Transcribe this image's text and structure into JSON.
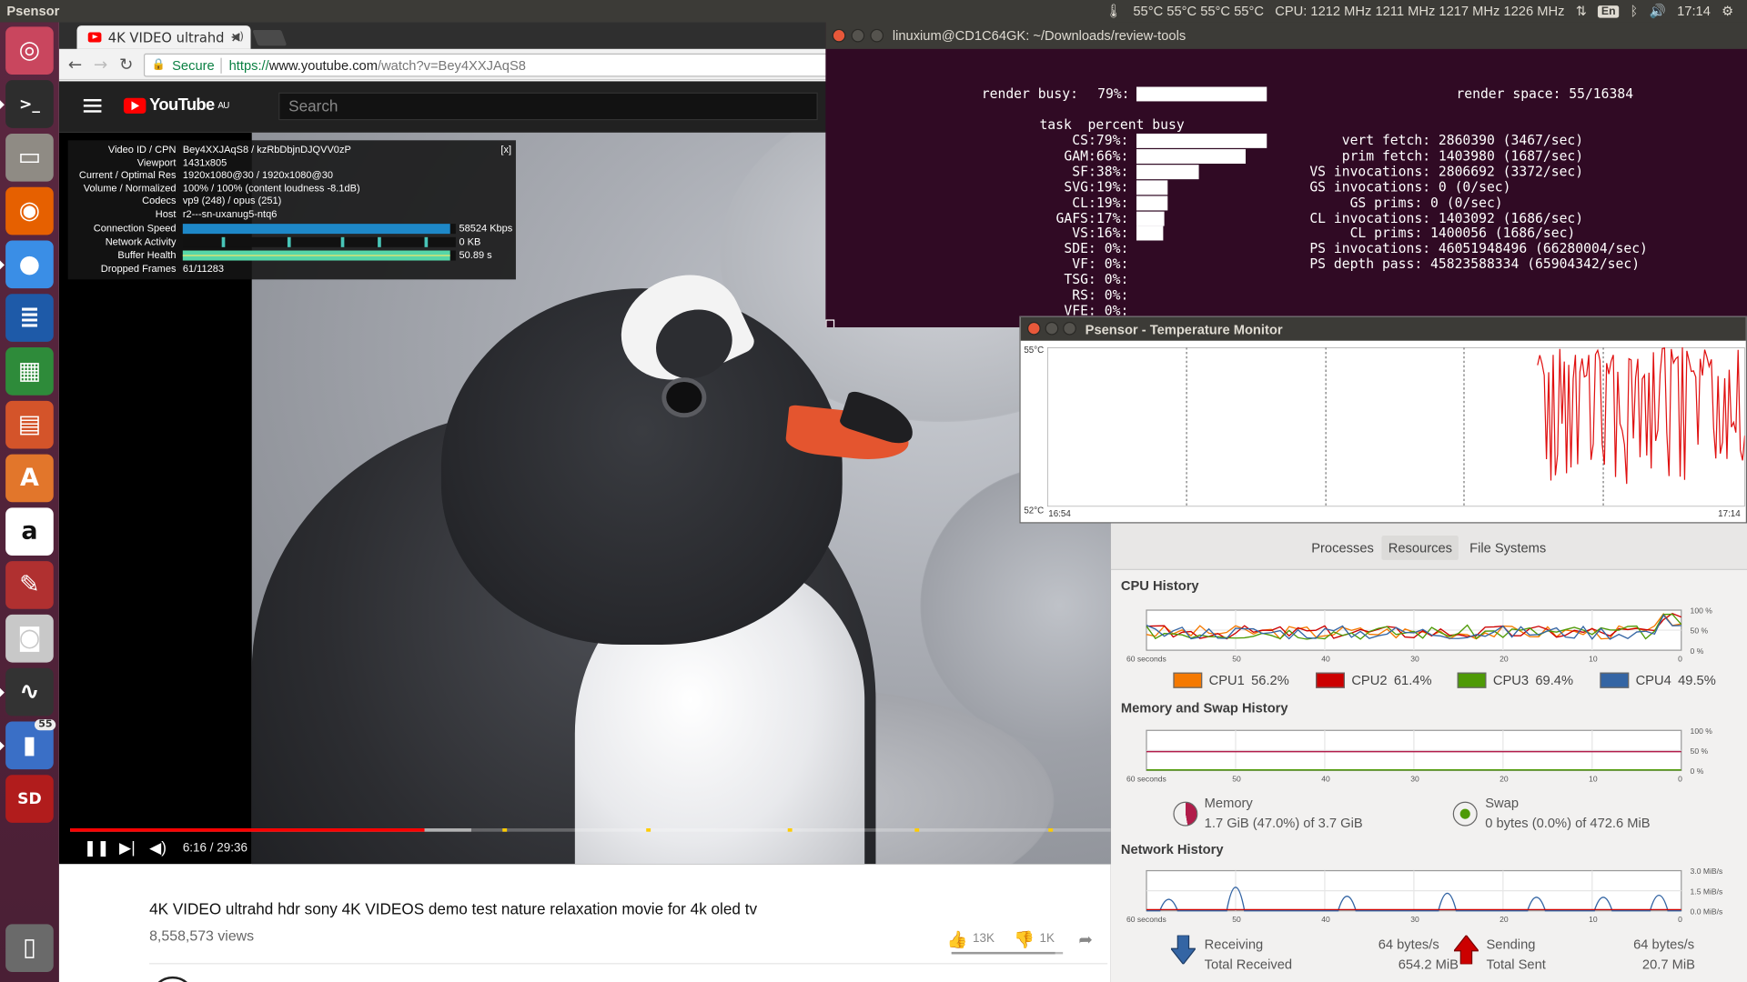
{
  "top_panel": {
    "app_title": "Psensor",
    "temps": "55°C 55°C 55°C 55°C",
    "cpu_freqs": "CPU: 1212 MHz 1211 MHz 1217 MHz 1226 MHz",
    "keyboard_layout": "En",
    "clock": "17:14"
  },
  "launcher": {
    "items": [
      {
        "name": "ubuntu-dash",
        "glyph": "◎",
        "color": "#c9465e"
      },
      {
        "name": "terminal",
        "glyph": ">_",
        "color": "#2d2d2d"
      },
      {
        "name": "files",
        "glyph": "▭",
        "color": "#8f8b84"
      },
      {
        "name": "firefox",
        "glyph": "◉",
        "color": "#e66000"
      },
      {
        "name": "chrome",
        "glyph": "●",
        "color": "#3a8ee6"
      },
      {
        "name": "writer",
        "glyph": "≣",
        "color": "#1e5aa8"
      },
      {
        "name": "calc",
        "glyph": "▦",
        "color": "#2e8b3a"
      },
      {
        "name": "impress",
        "glyph": "▤",
        "color": "#d4542a"
      },
      {
        "name": "software-center",
        "glyph": "A",
        "color": "#e2762b"
      },
      {
        "name": "amazon",
        "glyph": "a",
        "color": "#ffffff"
      },
      {
        "name": "system-settings",
        "glyph": "✎",
        "color": "#b03030"
      },
      {
        "name": "camera",
        "glyph": "◙",
        "color": "#c8c8c8"
      },
      {
        "name": "system-monitor",
        "glyph": "∿",
        "color": "#333333"
      },
      {
        "name": "psensor",
        "glyph": "▮",
        "color": "#3a6fc6",
        "badge": "55"
      },
      {
        "name": "sd-card",
        "glyph": "SD",
        "color": "#b11c1c"
      },
      {
        "name": "trash",
        "glyph": "▯",
        "color": "#6a6a6a"
      }
    ]
  },
  "browser": {
    "tab_title": "4K VIDEO ultrahd",
    "secure_label": "Secure",
    "url_scheme": "https://",
    "url_host": "www.youtube.com",
    "url_path": "/watch?v=Bey4XXJAqS8",
    "yt_region": "AU",
    "yt_logo": "YouTube",
    "search_placeholder": "Search"
  },
  "stats": {
    "close": "[x]",
    "rows": [
      {
        "key": "Video ID / CPN",
        "val": "Bey4XXJAqS8 / kzRbDbjnDJQVV0zP"
      },
      {
        "key": "Viewport",
        "val": "1431x805"
      },
      {
        "key": "Current / Optimal Res",
        "val": "1920x1080@30 / 1920x1080@30"
      },
      {
        "key": "Volume / Normalized",
        "val": "100% / 100% (content loudness -8.1dB)"
      },
      {
        "key": "Codecs",
        "val": "vp9 (248) / opus (251)"
      },
      {
        "key": "Host",
        "val": "r2---sn-uxanug5-ntq6"
      }
    ],
    "bars": [
      {
        "key": "Connection Speed",
        "val": "58524 Kbps",
        "color": "#1e88c8",
        "fill": 0.98
      },
      {
        "key": "Network Activity",
        "val": "0 KB",
        "color": "#48c5b8",
        "fill": 0.0
      },
      {
        "key": "Buffer Health",
        "val": "50.89 s",
        "color": "#56d6a8",
        "fill": 0.98
      }
    ],
    "dropped_key": "Dropped Frames",
    "dropped_val": "61/11283"
  },
  "player": {
    "played_fraction": 0.34,
    "buffered_fraction": 0.385,
    "markers": [
      0.415,
      0.553,
      0.69,
      0.812,
      0.94
    ],
    "time": "6:16 / 29:36"
  },
  "video": {
    "title": "4K VIDEO ultrahd hdr sony 4K VIDEOS demo test nature relaxation movie for 4k oled tv",
    "views": "8,558,573 views",
    "likes": "13K",
    "dislikes": "1K"
  },
  "terminal": {
    "title": "linuxium@CD1C64GK: ~/Downloads/review-tools",
    "render_busy_label": "render busy:",
    "render_busy_pct": "79%:",
    "render_busy_value": 79,
    "render_space": "render space: 55/16384",
    "header": "task  percent busy",
    "tasks": [
      {
        "name": "CS:",
        "pct": "79%:",
        "value": 79
      },
      {
        "name": "GAM:",
        "pct": "66%:",
        "value": 66
      },
      {
        "name": "SF:",
        "pct": "38%:",
        "value": 38
      },
      {
        "name": "SVG:",
        "pct": "19%:",
        "value": 19
      },
      {
        "name": "CL:",
        "pct": "19%:",
        "value": 19
      },
      {
        "name": "GAFS:",
        "pct": "17%:",
        "value": 17
      },
      {
        "name": "VS:",
        "pct": "16%:",
        "value": 16
      },
      {
        "name": "SDE:",
        "pct": "0%:",
        "value": 0
      },
      {
        "name": "VF:",
        "pct": "0%:",
        "value": 0
      },
      {
        "name": "TSG:",
        "pct": "0%:",
        "value": 0
      },
      {
        "name": "RS:",
        "pct": "0%:",
        "value": 0
      },
      {
        "name": "VFE:",
        "pct": "0%:",
        "value": 0
      }
    ],
    "stats": [
      "      vert fetch: 2860390 (3467/sec)",
      "      prim fetch: 1403980 (1687/sec)",
      "  VS invocations: 2806692 (3372/sec)",
      "  GS invocations: 0 (0/sec)",
      "       GS prims: 0 (0/sec)",
      "  CL invocations: 1403092 (1686/sec)",
      "       CL prims: 1400056 (1686/sec)",
      "  PS invocations: 46051948496 (66280004/sec)",
      "  PS depth pass: 45823588334 (65904342/sec)"
    ]
  },
  "psensor": {
    "title": "Psensor - Temperature Monitor",
    "y_max": "55°C",
    "y_min": "52°C",
    "x_start": "16:54",
    "x_end": "17:14"
  },
  "sysmon": {
    "tabs": [
      "Processes",
      "Resources",
      "File Systems"
    ],
    "active_tab": 1,
    "cpu_section": "CPU History",
    "mem_section": "Memory and Swap History",
    "net_section": "Network History",
    "cpu_y_labels": [
      "100 %",
      "50 %",
      "0 %"
    ],
    "x_labels": [
      "60 seconds",
      "50",
      "40",
      "30",
      "20",
      "10",
      "0"
    ],
    "net_y_labels": [
      "3.0 MiB/s",
      "1.5 MiB/s",
      "0.0 MiB/s"
    ],
    "cpus": [
      {
        "label": "CPU1",
        "value": "56.2%",
        "color": "#f57900"
      },
      {
        "label": "CPU2",
        "value": "61.4%",
        "color": "#cc0000"
      },
      {
        "label": "CPU3",
        "value": "69.4%",
        "color": "#4e9a06"
      },
      {
        "label": "CPU4",
        "value": "49.5%",
        "color": "#3465a4"
      }
    ],
    "memory_label": "Memory",
    "memory_value": "1.7 GiB (47.0%) of 3.7 GiB",
    "swap_label": "Swap",
    "swap_value": "0 bytes (0.0%) of 472.6 MiB",
    "receiving_label": "Receiving",
    "receiving_rate": "64 bytes/s",
    "total_received_label": "Total Received",
    "total_received": "654.2 MiB",
    "sending_label": "Sending",
    "sending_rate": "64 bytes/s",
    "total_sent_label": "Total Sent",
    "total_sent": "20.7 MiB"
  }
}
